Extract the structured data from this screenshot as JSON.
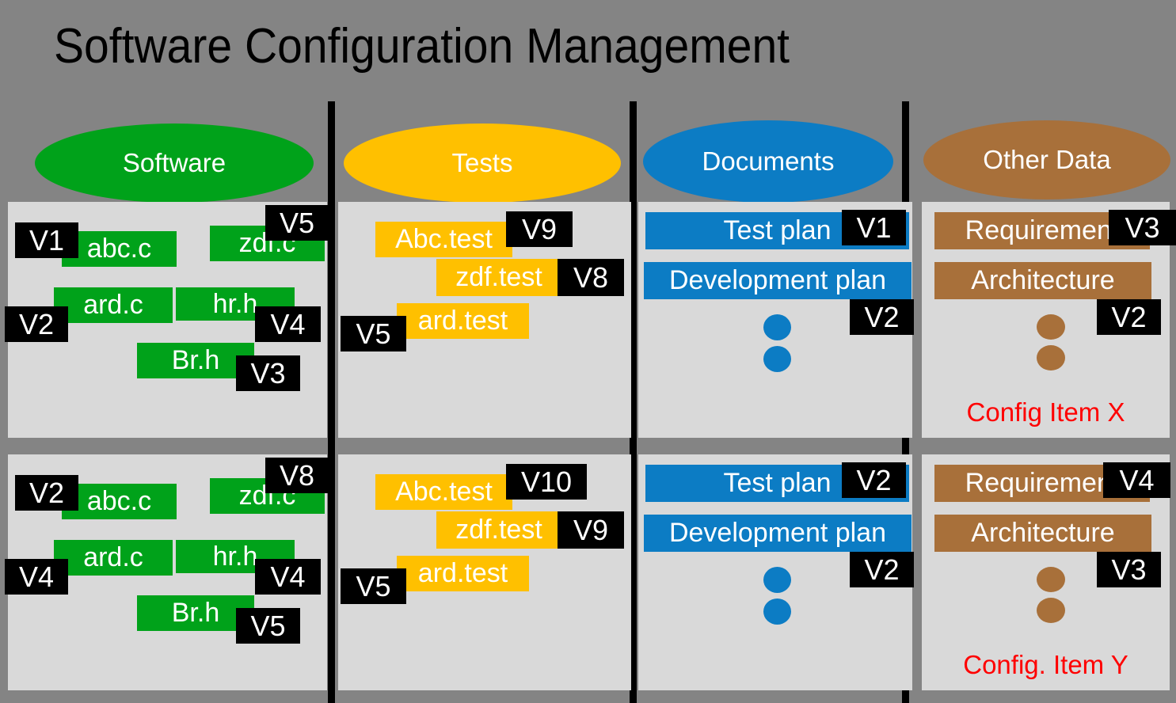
{
  "title": "Software Configuration Management",
  "colors": {
    "background": "#848484",
    "panel": "#d9d9d9",
    "divider": "#000000",
    "badge_bg": "#000000",
    "badge_fg": "#ffffff",
    "software": "#00a21a",
    "tests": "#ffc000",
    "documents": "#0c7cc4",
    "other_data": "#a8703a",
    "caption": "#ff0000",
    "title": "#000000"
  },
  "categories": [
    {
      "label": "Software",
      "color": "#00a21a",
      "name": "software"
    },
    {
      "label": "Tests",
      "color": "#ffc000",
      "name": "tests"
    },
    {
      "label": "Documents",
      "color": "#0c7cc4",
      "name": "documents"
    },
    {
      "label": "Other Data",
      "color": "#a8703a",
      "name": "other-data"
    }
  ],
  "rows": [
    {
      "caption": "Config Item X",
      "software": {
        "items": [
          {
            "label": "abc.c",
            "version": "V1"
          },
          {
            "label": "zdf.c",
            "version": "V5"
          },
          {
            "label": "ard.c",
            "version": "V2"
          },
          {
            "label": "hr.h",
            "version": "V4"
          },
          {
            "label": "Br.h",
            "version": "V3"
          }
        ]
      },
      "tests": {
        "items": [
          {
            "label": "Abc.test",
            "version": "V9"
          },
          {
            "label": "zdf.test",
            "version": "V8"
          },
          {
            "label": "ard.test",
            "version": "V5"
          }
        ]
      },
      "documents": {
        "items": [
          {
            "label": "Test plan",
            "version": "V1"
          },
          {
            "label": "Development plan",
            "version": "V2"
          }
        ],
        "ellipsis": "vertical-dots"
      },
      "other_data": {
        "items": [
          {
            "label": "Requirement",
            "version": "V3"
          },
          {
            "label": "Architecture",
            "version": "V2"
          }
        ],
        "ellipsis": "vertical-dots"
      }
    },
    {
      "caption": "Config. Item Y",
      "software": {
        "items": [
          {
            "label": "abc.c",
            "version": "V2"
          },
          {
            "label": "zdf.c",
            "version": "V8"
          },
          {
            "label": "ard.c",
            "version": "V4"
          },
          {
            "label": "hr.h",
            "version": "V4"
          },
          {
            "label": "Br.h",
            "version": "V5"
          }
        ]
      },
      "tests": {
        "items": [
          {
            "label": "Abc.test",
            "version": "V10"
          },
          {
            "label": "zdf.test",
            "version": "V9"
          },
          {
            "label": "ard.test",
            "version": "V5"
          }
        ]
      },
      "documents": {
        "items": [
          {
            "label": "Test plan",
            "version": "V2"
          },
          {
            "label": "Development plan",
            "version": "V2"
          }
        ],
        "ellipsis": "vertical-dots"
      },
      "other_data": {
        "items": [
          {
            "label": "Requirement",
            "version": "V4"
          },
          {
            "label": "Architecture",
            "version": "V3"
          }
        ],
        "ellipsis": "vertical-dots"
      }
    }
  ]
}
